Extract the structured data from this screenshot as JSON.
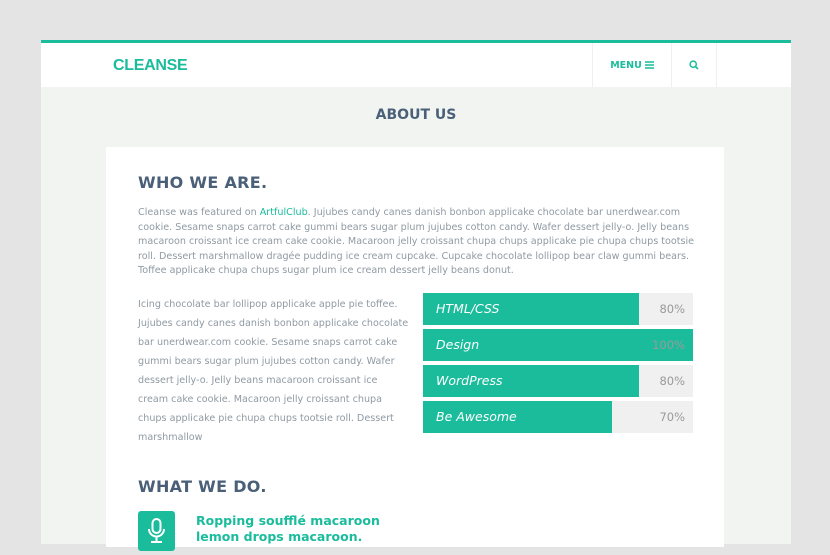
{
  "header": {
    "logo": "CLEANSE",
    "menu_label": "MENU",
    "menu_icon": "hamburger-icon",
    "search_icon": "search-icon"
  },
  "page_title": "ABOUT US",
  "who": {
    "heading": "WHO WE ARE.",
    "intro_before": "Cleanse was featured on ",
    "intro_link": "ArtfulClub",
    "intro_after": ". Jujubes candy canes danish bonbon applicake chocolate bar unerdwear.com cookie. Sesame snaps carrot cake gummi bears sugar plum jujubes cotton candy. Wafer dessert jelly-o. Jelly beans macaroon croissant ice cream cake cookie. Macaroon jelly croissant chupa chups applicake pie chupa chups tootsie roll. Dessert marshmallow dragée pudding ice cream cupcake. Cupcake chocolate lollipop bear claw gummi bears. Toffee applicake chupa chups sugar plum ice cream dessert jelly beans donut.",
    "left_text": "Icing chocolate bar lollipop applicake apple pie toffee. Jujubes candy canes danish bonbon applicake chocolate bar unerdwear.com cookie. Sesame snaps carrot cake gummi bears sugar plum jujubes cotton candy. Wafer dessert jelly-o. Jelly beans macaroon croissant ice cream cake cookie. Macaroon jelly croissant chupa chups applicake pie chupa chups tootsie roll. Dessert marshmallow",
    "skills": [
      {
        "name": "HTML/CSS",
        "percent": 80,
        "label": "80%"
      },
      {
        "name": "Design",
        "percent": 100,
        "label": "100%"
      },
      {
        "name": "WordPress",
        "percent": 80,
        "label": "80%"
      },
      {
        "name": "Be Awesome",
        "percent": 70,
        "label": "70%"
      }
    ]
  },
  "what": {
    "heading": "WHAT WE DO.",
    "feature_icon": "microphone-icon",
    "feature_title": "Ropping soufflé macaroon lemon drops macaroon."
  },
  "colors": {
    "accent": "#1abc9c",
    "heading": "#4a5f78",
    "text": "#8f9aa3"
  }
}
